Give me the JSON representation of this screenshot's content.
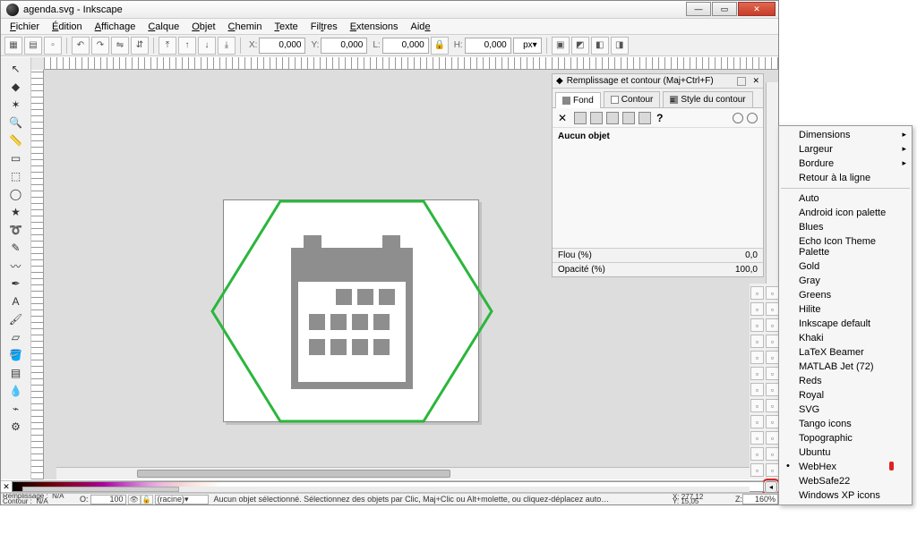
{
  "window": {
    "title": "agenda.svg - Inkscape"
  },
  "menubar": [
    {
      "label": "Fichier",
      "u": 0
    },
    {
      "label": "Édition",
      "u": 0
    },
    {
      "label": "Affichage",
      "u": 0
    },
    {
      "label": "Calque",
      "u": 0
    },
    {
      "label": "Objet",
      "u": 0
    },
    {
      "label": "Chemin",
      "u": 0
    },
    {
      "label": "Texte",
      "u": 0
    },
    {
      "label": "Filtres",
      "u": 3
    },
    {
      "label": "Extensions",
      "u": 0
    },
    {
      "label": "Aide",
      "u": 3
    }
  ],
  "toolbar": {
    "x_label": "X:",
    "x_val": "0,000",
    "y_label": "Y:",
    "y_val": "0,000",
    "w_label": "L:",
    "w_val": "0,000",
    "lock": "🔒",
    "h_label": "H:",
    "h_val": "0,000",
    "unit": "px"
  },
  "dock": {
    "title": "Remplissage et contour (Maj+Ctrl+F)",
    "tabs": {
      "fill": "Fond",
      "stroke": "Contour",
      "style": "Style du contour"
    },
    "nosel": "Aucun objet",
    "blur_label": "Flou (%)",
    "blur_val": "0,0",
    "opa_label": "Opacité (%)",
    "opa_val": "100,0"
  },
  "ctxmenu": {
    "sub": [
      {
        "label": "Dimensions",
        "arrow": true
      },
      {
        "label": "Largeur",
        "arrow": true
      },
      {
        "label": "Bordure",
        "arrow": true
      },
      {
        "label": "Retour à la ligne"
      }
    ],
    "palettes": [
      "Auto",
      "Android icon palette",
      "Blues",
      "Echo Icon Theme Palette",
      "Gold",
      "Gray",
      "Greens",
      "Hilite",
      "Inkscape default",
      "Khaki",
      "LaTeX Beamer",
      "MATLAB Jet (72)",
      "Reds",
      "Royal",
      "SVG",
      "Tango icons",
      "Topographic",
      "Ubuntu",
      "WebHex",
      "WebSafe22",
      "Windows XP icons"
    ],
    "selected": "WebHex"
  },
  "status": {
    "fill_label": "Remplissage :",
    "fill_val": "N/A",
    "stroke_label": "Contour :",
    "stroke_val": "N/A",
    "opacity_label": "O:",
    "opacity_val": "100",
    "layer": "(racine)",
    "message": "Aucun objet sélectionné. Sélectionnez des objets par Clic, Maj+Clic ou Alt+molette, ou cliquez-déplacez auto…",
    "x_label": "X:",
    "x_val": "277,12",
    "y_label": "Y:",
    "y_val": "15,05",
    "z_label": "Z:",
    "z_val": "160%"
  },
  "toolbox_icons": [
    "cursor",
    "node",
    "tweak",
    "zoom",
    "measure",
    "rect",
    "cube",
    "circle",
    "star",
    "spiral",
    "pencil",
    "bezier",
    "calligraphy",
    "text",
    "spray",
    "eraser",
    "fill",
    "gradient",
    "dropper",
    "connector",
    "lpe"
  ],
  "cmdstrip_icons": [
    "new",
    "open",
    "save",
    "print",
    "undo",
    "redo",
    "copy",
    "paste",
    "cut",
    "zoom-fit",
    "zoom-page",
    "zoom-draw",
    "duplicate",
    "clone",
    "group",
    "ungroup",
    "fill-dialog",
    "text-dialog",
    "xml",
    "align",
    "transform",
    "layers",
    "prefs",
    "doc-props"
  ]
}
